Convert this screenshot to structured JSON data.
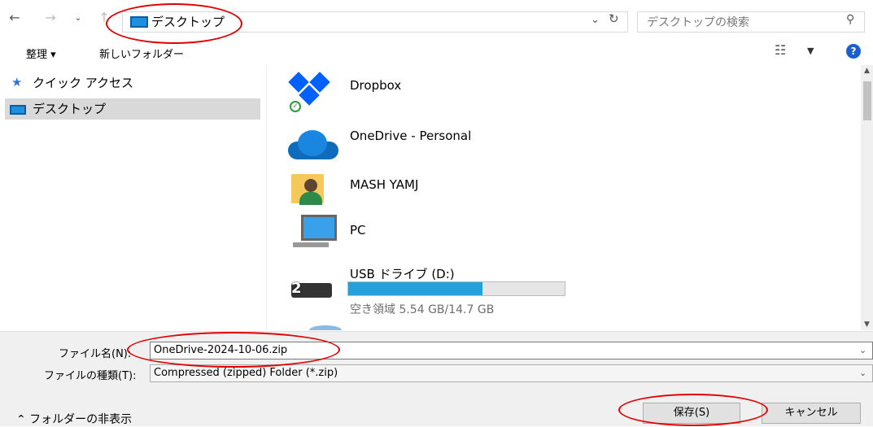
{
  "address": {
    "location": "デスクトップ",
    "search_placeholder": "デスクトップの検索"
  },
  "toolbar": {
    "organize": "整理 ▾",
    "new_folder": "新しいフォルダー"
  },
  "nav": {
    "quick_access": "クイック アクセス",
    "desktop": "デスクトップ"
  },
  "items": [
    {
      "name": "Dropbox"
    },
    {
      "name": "OneDrive - Personal"
    },
    {
      "name": "MASH YAMJ"
    },
    {
      "name": "PC"
    },
    {
      "name": "USB ドライブ (D:)",
      "free_space": "空き領域 5.54 GB/14.7 GB",
      "used_fraction": 0.62
    }
  ],
  "form": {
    "filename_label": "ファイル名(N):",
    "filename_value": "OneDrive-2024-10-06.zip",
    "filetype_label": "ファイルの種類(T):",
    "filetype_value": "Compressed (zipped) Folder (*.zip)"
  },
  "footer": {
    "hide_folders": "⌃ フォルダーの非表示",
    "save": "保存(S)",
    "cancel": "キャンセル"
  },
  "colors": {
    "annotation": "#e00000",
    "accent": "#1e90e0",
    "progress": "#26a0da"
  }
}
